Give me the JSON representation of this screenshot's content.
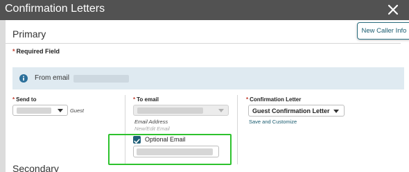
{
  "window": {
    "title": "Confirmation Letters",
    "close_icon": "close-icon"
  },
  "primary": {
    "title": "Primary",
    "required_text": "Required Field"
  },
  "secondary": {
    "title": "Secondary"
  },
  "new_caller_button": "New Caller Info",
  "info_banner": {
    "icon": "info-icon",
    "text": "From email"
  },
  "send_to": {
    "label": "Send to",
    "value_suffix": "Guest"
  },
  "to_email": {
    "label": "To email",
    "caption": "Email Address",
    "new_edit": "New/Edit Email"
  },
  "optional_email": {
    "label": "Optional Email",
    "checked": true
  },
  "confirmation_letter": {
    "label": "Confirmation Letter",
    "value": "Guest Confirmation Letter",
    "link": "Save and Customize"
  },
  "colors": {
    "titlebar": "#525252",
    "accent": "#175a6e",
    "info_bg": "#dfeaf1",
    "highlight": "#2dc22d",
    "required": "#c0392b"
  }
}
